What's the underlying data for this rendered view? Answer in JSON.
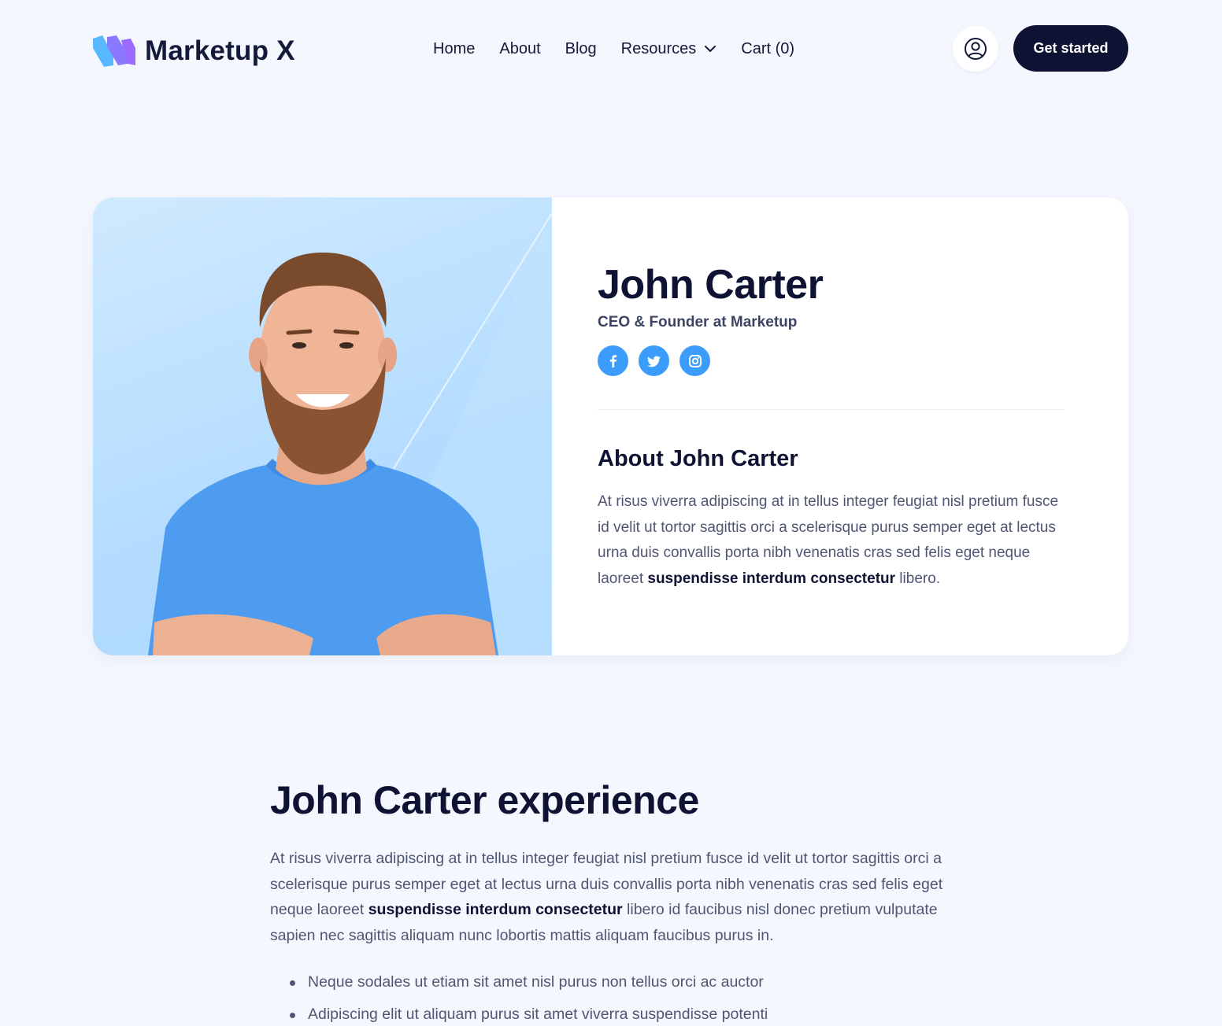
{
  "header": {
    "brand": "Marketup X",
    "nav": [
      {
        "label": "Home"
      },
      {
        "label": "About"
      },
      {
        "label": "Blog"
      },
      {
        "label": "Resources"
      },
      {
        "label": "Cart (0)"
      }
    ],
    "account_icon": "user-circle-icon",
    "cta_label": "Get started"
  },
  "profile": {
    "name": "John Carter",
    "role": "CEO & Founder at Marketup",
    "socials": [
      "facebook-icon",
      "twitter-icon",
      "instagram-icon"
    ],
    "about_title": "About John Carter",
    "about_text_pre": "At risus viverra adipiscing at in tellus integer feugiat nisl pretium fusce id velit ut tortor sagittis orci a scelerisque purus semper eget at lectus urna duis convallis porta nibh venenatis cras sed felis eget neque laoreet ",
    "about_text_bold": "suspendisse interdum consectetur",
    "about_text_post": " libero."
  },
  "experience": {
    "title": "John Carter experience",
    "text_pre": "At risus viverra adipiscing at in tellus integer feugiat nisl pretium fusce id velit ut tortor sagittis orci a scelerisque purus semper eget at lectus urna duis convallis porta nibh venenatis cras sed felis eget neque laoreet ",
    "text_bold": "suspendisse interdum consectetur",
    "text_post": " libero id faucibus nisl donec pretium vulputate sapien nec sagittis aliquam nunc lobortis mattis aliquam faucibus purus in.",
    "bullets": [
      "Neque sodales ut etiam sit amet nisl purus non tellus orci ac auctor",
      "Adipiscing elit ut aliquam purus sit amet viverra suspendisse potenti"
    ]
  },
  "colors": {
    "background": "#f5f7fe",
    "navy": "#0f1333",
    "accent_blue": "#3b9cfb",
    "logo_blue": "#57b7ff",
    "logo_purple": "#9b6bff"
  }
}
